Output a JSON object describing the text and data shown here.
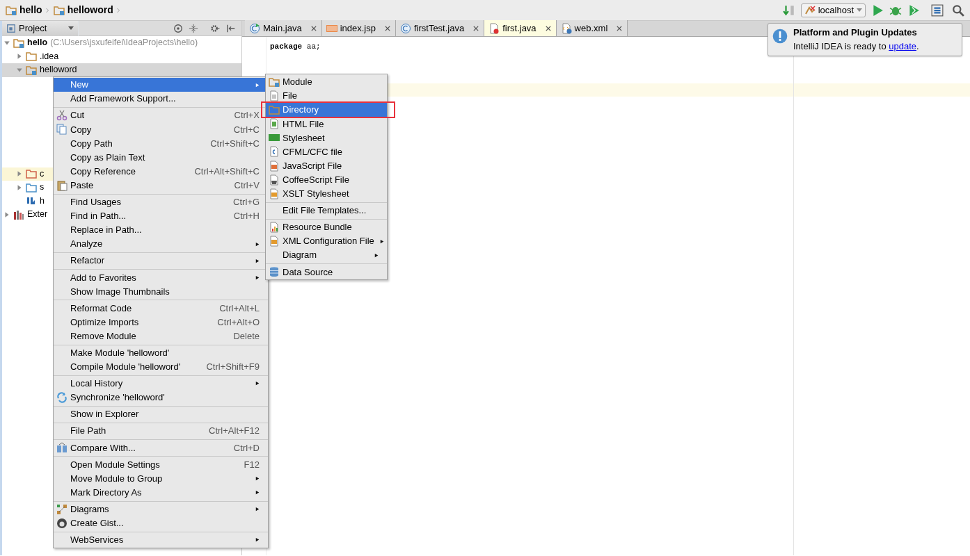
{
  "breadcrumbs": [
    {
      "label": "hello"
    },
    {
      "label": "helloword"
    }
  ],
  "toolbar": {
    "run_config": "localhost"
  },
  "project_panel": {
    "title": "Project",
    "tree": [
      {
        "label": "hello",
        "path": "(C:\\Users\\jsxufeifei\\IdeaProjects\\hello)",
        "expanded": true,
        "selected": false,
        "highlighted": false,
        "children": [
          {
            "label": ".idea",
            "expanded": false,
            "selected": false,
            "highlighted": false
          },
          {
            "label": "helloword",
            "expanded": true,
            "selected": true,
            "highlighted": false
          },
          {
            "label": "c",
            "expanded": false,
            "selected": false,
            "highlighted": true
          },
          {
            "label": "s",
            "expanded": false,
            "selected": false,
            "highlighted": false
          },
          {
            "label": "h",
            "selected": false,
            "highlighted": false
          }
        ]
      },
      {
        "label": "Exter",
        "expanded": false,
        "selected": false,
        "highlighted": false
      }
    ]
  },
  "tabs": [
    {
      "label": "Main.java",
      "selected": false
    },
    {
      "label": "index.jsp",
      "selected": false
    },
    {
      "label": "firstTest.java",
      "selected": false
    },
    {
      "label": "first.java",
      "selected": true
    },
    {
      "label": "web.xml",
      "selected": false
    }
  ],
  "editor": {
    "lines": [
      "**package** aa;"
    ]
  },
  "notification": {
    "title": "Platform and Plugin Updates",
    "text": "IntelliJ IDEA is ready to ",
    "link": "update",
    "text_after": "."
  },
  "context_menu": {
    "groups": [
      [
        {
          "label": "New",
          "submenu": true,
          "selected": true
        },
        {
          "label": "Add Framework Support...",
          "submenu": false,
          "selected": false
        }
      ],
      [
        {
          "label": "Cut",
          "shortcut": "Ctrl+X",
          "submenu": false,
          "selected": false
        },
        {
          "label": "Copy",
          "shortcut": "Ctrl+C",
          "submenu": false,
          "selected": false
        },
        {
          "label": "Copy Path",
          "shortcut": "Ctrl+Shift+C",
          "submenu": false,
          "selected": false
        },
        {
          "label": "Copy as Plain Text",
          "submenu": false,
          "selected": false
        },
        {
          "label": "Copy Reference",
          "shortcut": "Ctrl+Alt+Shift+C",
          "submenu": false,
          "selected": false
        },
        {
          "label": "Paste",
          "shortcut": "Ctrl+V",
          "submenu": false,
          "selected": false
        }
      ],
      [
        {
          "label": "Find Usages",
          "shortcut": "Ctrl+G",
          "submenu": false,
          "selected": false
        },
        {
          "label": "Find in Path...",
          "shortcut": "Ctrl+H",
          "submenu": false,
          "selected": false
        },
        {
          "label": "Replace in Path...",
          "submenu": false,
          "selected": false
        },
        {
          "label": "Analyze",
          "submenu": true,
          "selected": false
        }
      ],
      [
        {
          "label": "Refactor",
          "submenu": true,
          "selected": false
        }
      ],
      [
        {
          "label": "Add to Favorites",
          "submenu": true,
          "selected": false
        },
        {
          "label": "Show Image Thumbnails",
          "submenu": false,
          "selected": false
        }
      ],
      [
        {
          "label": "Reformat Code",
          "shortcut": "Ctrl+Alt+L",
          "submenu": false,
          "selected": false
        },
        {
          "label": "Optimize Imports",
          "shortcut": "Ctrl+Alt+O",
          "submenu": false,
          "selected": false
        },
        {
          "label": "Remove Module",
          "shortcut": "Delete",
          "submenu": false,
          "selected": false
        }
      ],
      [
        {
          "label": "Make Module 'helloword'",
          "submenu": false,
          "selected": false
        },
        {
          "label": "Compile Module 'helloword'",
          "shortcut": "Ctrl+Shift+F9",
          "submenu": false,
          "selected": false
        }
      ],
      [
        {
          "label": "Local History",
          "submenu": true,
          "selected": false
        },
        {
          "label": "Synchronize 'helloword'",
          "submenu": false,
          "selected": false
        }
      ],
      [
        {
          "label": "Show in Explorer",
          "submenu": false,
          "selected": false
        }
      ],
      [
        {
          "label": "File Path",
          "shortcut": "Ctrl+Alt+F12",
          "submenu": false,
          "selected": false
        }
      ],
      [
        {
          "label": "Compare With...",
          "shortcut": "Ctrl+D",
          "submenu": false,
          "selected": false
        }
      ],
      [
        {
          "label": "Open Module Settings",
          "shortcut": "F12",
          "submenu": false,
          "selected": false
        },
        {
          "label": "Move Module to Group",
          "submenu": true,
          "selected": false
        },
        {
          "label": "Mark Directory As",
          "submenu": true,
          "selected": false
        }
      ],
      [
        {
          "label": "Diagrams",
          "submenu": true,
          "selected": false
        },
        {
          "label": "Create Gist...",
          "submenu": false,
          "selected": false
        }
      ],
      [
        {
          "label": "WebServices",
          "submenu": true,
          "selected": false
        }
      ]
    ]
  },
  "submenu": {
    "groups": [
      [
        {
          "label": "Module",
          "submenu": false,
          "selected": false
        },
        {
          "label": "File",
          "submenu": false,
          "selected": false
        },
        {
          "label": "Directory",
          "submenu": false,
          "selected": true
        },
        {
          "label": "HTML File",
          "submenu": false,
          "selected": false
        },
        {
          "label": "Stylesheet",
          "submenu": false,
          "selected": false
        },
        {
          "label": "CFML/CFC file",
          "submenu": false,
          "selected": false
        },
        {
          "label": "JavaScript File",
          "submenu": false,
          "selected": false
        },
        {
          "label": "CoffeeScript File",
          "submenu": false,
          "selected": false
        },
        {
          "label": "XSLT Stylesheet",
          "submenu": false,
          "selected": false
        }
      ],
      [
        {
          "label": "Edit File Templates...",
          "submenu": false,
          "selected": false
        }
      ],
      [
        {
          "label": "Resource Bundle",
          "submenu": false,
          "selected": false
        },
        {
          "label": "XML Configuration File",
          "submenu": true,
          "selected": false
        },
        {
          "label": "Diagram",
          "submenu": true,
          "selected": false
        }
      ],
      [
        {
          "label": "Data Source",
          "submenu": false,
          "selected": false
        }
      ]
    ]
  }
}
